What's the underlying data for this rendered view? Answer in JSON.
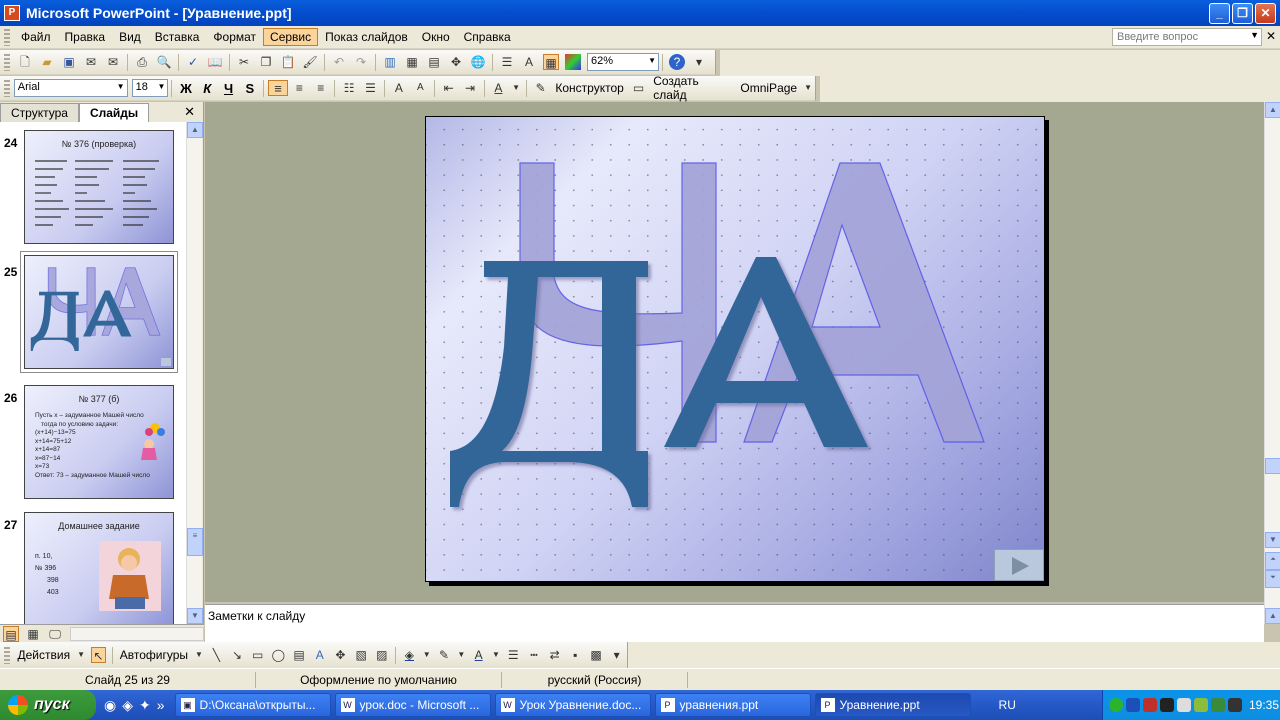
{
  "window": {
    "title": "Microsoft PowerPoint - [Уравнение.ppt]"
  },
  "menu": {
    "items": [
      "Файл",
      "Правка",
      "Вид",
      "Вставка",
      "Формат",
      "Сервис",
      "Показ слайдов",
      "Окно",
      "Справка"
    ],
    "active_item": "Сервис",
    "help_placeholder": "Введите вопрос"
  },
  "toolbar": {
    "zoom": "62%"
  },
  "format_toolbar": {
    "font": "Arial",
    "size": "18",
    "bold": "Ж",
    "italic": "К",
    "underline": "Ч",
    "shadow": "S",
    "designer": "Конструктор",
    "new_slide": "Создать слайд",
    "omnipage": "OmniPage"
  },
  "left_pane": {
    "tabs": [
      "Структура",
      "Слайды"
    ],
    "selected_tab": "Слайды",
    "thumbnails": [
      {
        "num": "24",
        "title": "№ 376 (проверка)"
      },
      {
        "num": "25",
        "title": ""
      },
      {
        "num": "26",
        "title": "№ 377 (б)",
        "lines": [
          "Пусть x – задуманное Машей число",
          "тогда по условию задачи:",
          "(x+14)−13=75",
          "x+14=75+12",
          "x+14=87",
          "x=87−14",
          "x=73",
          "Ответ: 73 – задуманное Машей число"
        ]
      },
      {
        "num": "27",
        "title": "Домашнее задание",
        "lines": [
          "п. 10,",
          "№ 396",
          "398",
          "403"
        ]
      }
    ]
  },
  "slide": {
    "letters": [
      "Д",
      "И",
      "А"
    ]
  },
  "notes": {
    "placeholder": "Заметки к слайду"
  },
  "draw_toolbar": {
    "actions": "Действия",
    "autoshapes": "Автофигуры"
  },
  "status": {
    "slide": "Слайд 25 из 29",
    "design": "Оформление по умолчанию",
    "language": "русский (Россия)"
  },
  "taskbar": {
    "start": "пуск",
    "tasks": [
      "D:\\Оксана\\открыты...",
      "урок.doc - Microsoft ...",
      "Урок Уравнение.doc...",
      "уравнения.ppt",
      "Уравнение.ppt"
    ],
    "active_task": "Уравнение.ppt",
    "lang": "RU",
    "time": "19:35"
  },
  "colors": {
    "accent_blue": "#336699",
    "slide_lavender": "#a4a4d8"
  }
}
